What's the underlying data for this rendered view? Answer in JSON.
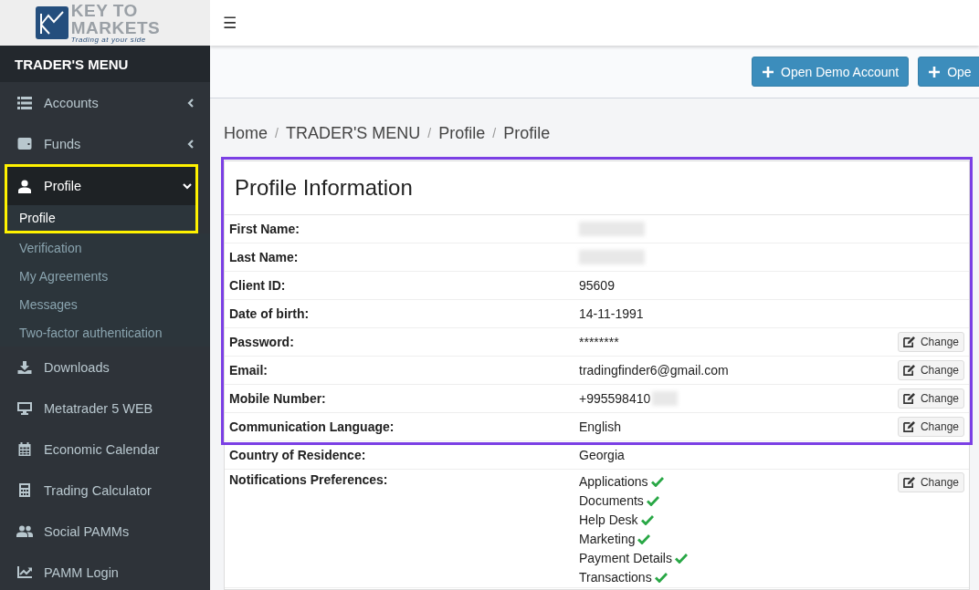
{
  "logo": {
    "line_1": "KEY TO",
    "line_2": "MARKETS",
    "tagline": "Trading at your side"
  },
  "sidebar": {
    "title": "TRADER'S MENU",
    "items": [
      {
        "label": "Accounts",
        "kind": "group",
        "expanded": false,
        "highlighted": false
      },
      {
        "label": "Funds",
        "kind": "group",
        "expanded": false,
        "highlighted": false
      },
      {
        "label": "Profile",
        "kind": "group",
        "expanded": true,
        "highlighted": true,
        "children": [
          {
            "label": "Profile",
            "selected": true,
            "highlighted": true
          },
          {
            "label": "Verification",
            "selected": false,
            "highlighted": false
          },
          {
            "label": "My Agreements",
            "selected": false,
            "highlighted": false
          },
          {
            "label": "Messages",
            "selected": false,
            "highlighted": false
          },
          {
            "label": "Two-factor authentication",
            "selected": false,
            "highlighted": false
          }
        ]
      },
      {
        "label": "Downloads",
        "kind": "link",
        "highlighted": false
      },
      {
        "label": "Metatrader 5 WEB",
        "kind": "link",
        "highlighted": false
      },
      {
        "label": "Economic Calendar",
        "kind": "link",
        "highlighted": false
      },
      {
        "label": "Trading Calculator",
        "kind": "link",
        "highlighted": false
      },
      {
        "label": "Social PAMMs",
        "kind": "link",
        "highlighted": false
      },
      {
        "label": "PAMM Login",
        "kind": "link",
        "highlighted": false
      }
    ]
  },
  "topbar": {
    "menu_toggle": "☰"
  },
  "actions": [
    {
      "label": "Open Demo Account"
    },
    {
      "label": "Ope"
    }
  ],
  "breadcrumb": {
    "separator": "/",
    "items": [
      "Home",
      "TRADER'S MENU",
      "Profile",
      "Profile"
    ]
  },
  "profile": {
    "title": "Profile Information",
    "highlighted": true,
    "rows": [
      {
        "label": "First Name:",
        "kind": "redacted"
      },
      {
        "label": "Last Name:",
        "kind": "redacted"
      },
      {
        "label": "Client ID:",
        "kind": "text",
        "value": "95609"
      },
      {
        "label": "Date of birth:",
        "kind": "text",
        "value": "14-11-1991"
      },
      {
        "label": "Password:",
        "kind": "text",
        "value": "********",
        "action": "Change"
      },
      {
        "label": "Email:",
        "kind": "text",
        "value": "tradingfinder6@gmail.com",
        "action": "Change"
      },
      {
        "label": "Mobile Number:",
        "kind": "partial",
        "value": "+995598410",
        "action": "Change"
      },
      {
        "label": "Communication Language:",
        "kind": "text",
        "value": "English",
        "action": "Change"
      }
    ],
    "more_rows": [
      {
        "label": "Country of Residence:",
        "kind": "text",
        "value": "Georgia"
      },
      {
        "label": "Notifications Preferences:",
        "kind": "list",
        "action": "Change",
        "items": [
          {
            "label": "Applications",
            "checked": true
          },
          {
            "label": "Documents",
            "checked": true
          },
          {
            "label": "Help Desk",
            "checked": true
          },
          {
            "label": "Marketing",
            "checked": true
          },
          {
            "label": "Payment Details",
            "checked": true
          },
          {
            "label": "Transactions",
            "checked": true
          }
        ]
      }
    ]
  }
}
